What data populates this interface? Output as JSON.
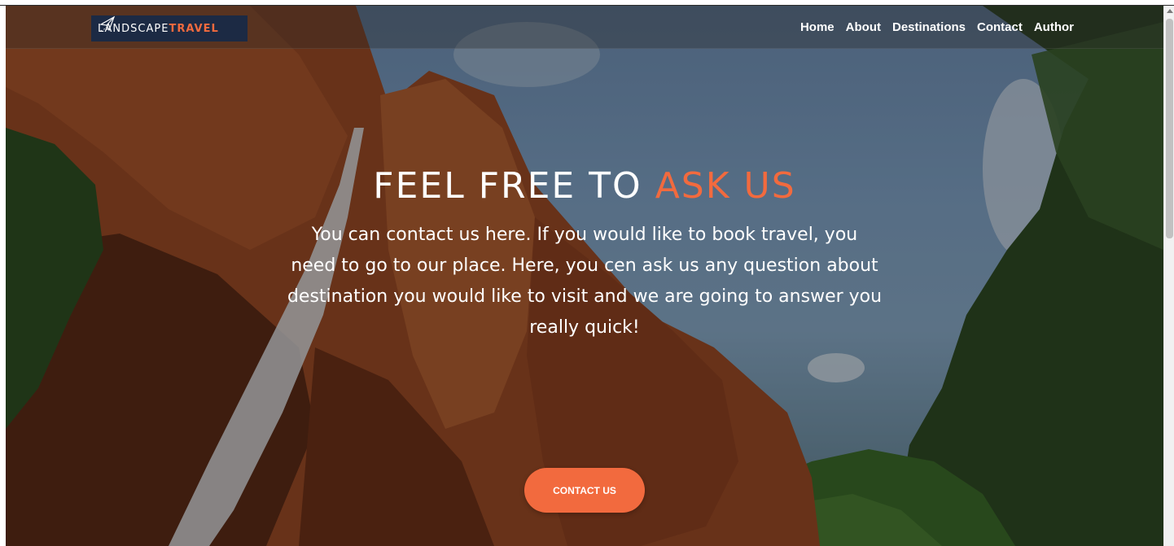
{
  "header": {
    "logo_part1": "LANDSCAPE",
    "logo_part2": "TRAVEL",
    "logo_icon": "paper-plane-icon",
    "nav": [
      "Home",
      "About",
      "Destinations",
      "Contact",
      "Author"
    ]
  },
  "hero": {
    "title_white": "FEEL FREE TO",
    "title_accent": "ASK US",
    "description": "You can contact us here. If you would like to book travel, you need to go to our place. Here, you cen ask us any question about destination you would like to visit and we are going to answer you really quick!",
    "cta_label": "CONTACT US"
  },
  "colors": {
    "accent": "#f26a3e",
    "logo_bg": "#1c2a44",
    "text": "#ffffff"
  }
}
